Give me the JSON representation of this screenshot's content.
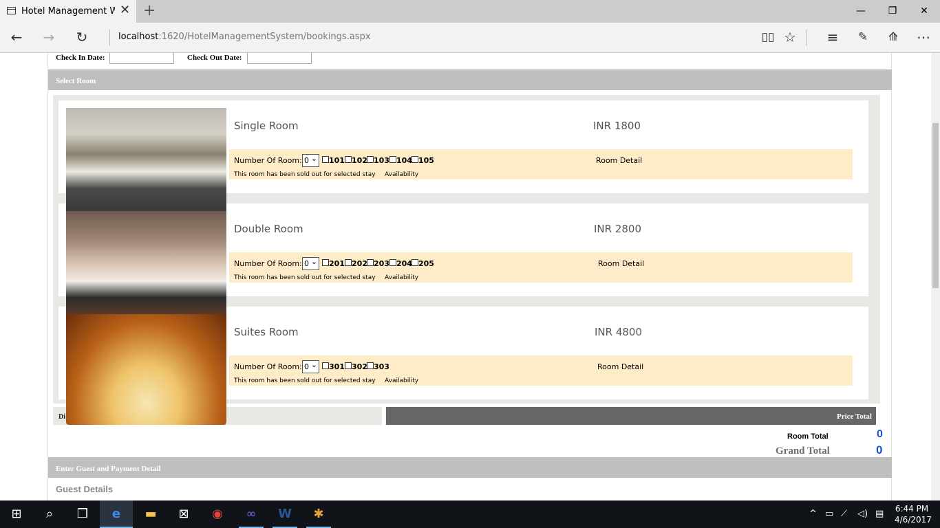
{
  "browser": {
    "tab_title": "Hotel Management Web",
    "url_host": "localhost",
    "url_rest": ":1620/HotelManagementSystem/bookings.aspx"
  },
  "form": {
    "check_in_label": "Check In Date:",
    "check_out_label": "Check Out Date:",
    "check_in_value": "",
    "check_out_value": "",
    "select_room_header": "Select Room",
    "number_of_room_label": "Number Of Room:",
    "sold_out_text": "This room has been sold out for selected stay",
    "availability_label": "Availability",
    "room_detail_label": "Room Detail",
    "rooms": [
      {
        "name": "Single Room",
        "price": "INR 1800",
        "selected": "0",
        "numbers": [
          "101",
          "102",
          "103",
          "104",
          "105"
        ]
      },
      {
        "name": "Double Room",
        "price": "INR 2800",
        "selected": "0",
        "numbers": [
          "201",
          "202",
          "203",
          "204",
          "205"
        ]
      },
      {
        "name": "Suites Room",
        "price": "INR 4800",
        "selected": "0",
        "numbers": [
          "301",
          "302",
          "303"
        ]
      }
    ],
    "discount_label_partial": "Di",
    "price_total_header": "Price Total",
    "room_total_label": "Room Total",
    "room_total_value": "0",
    "grand_total_label": "Grand Total",
    "grand_total_value": "0",
    "guest_payment_header": "Enter Guest and Payment Detail",
    "guest_details_label": "Guest Details"
  },
  "taskbar": {
    "time": "6:44 PM",
    "date": "4/6/2017"
  }
}
